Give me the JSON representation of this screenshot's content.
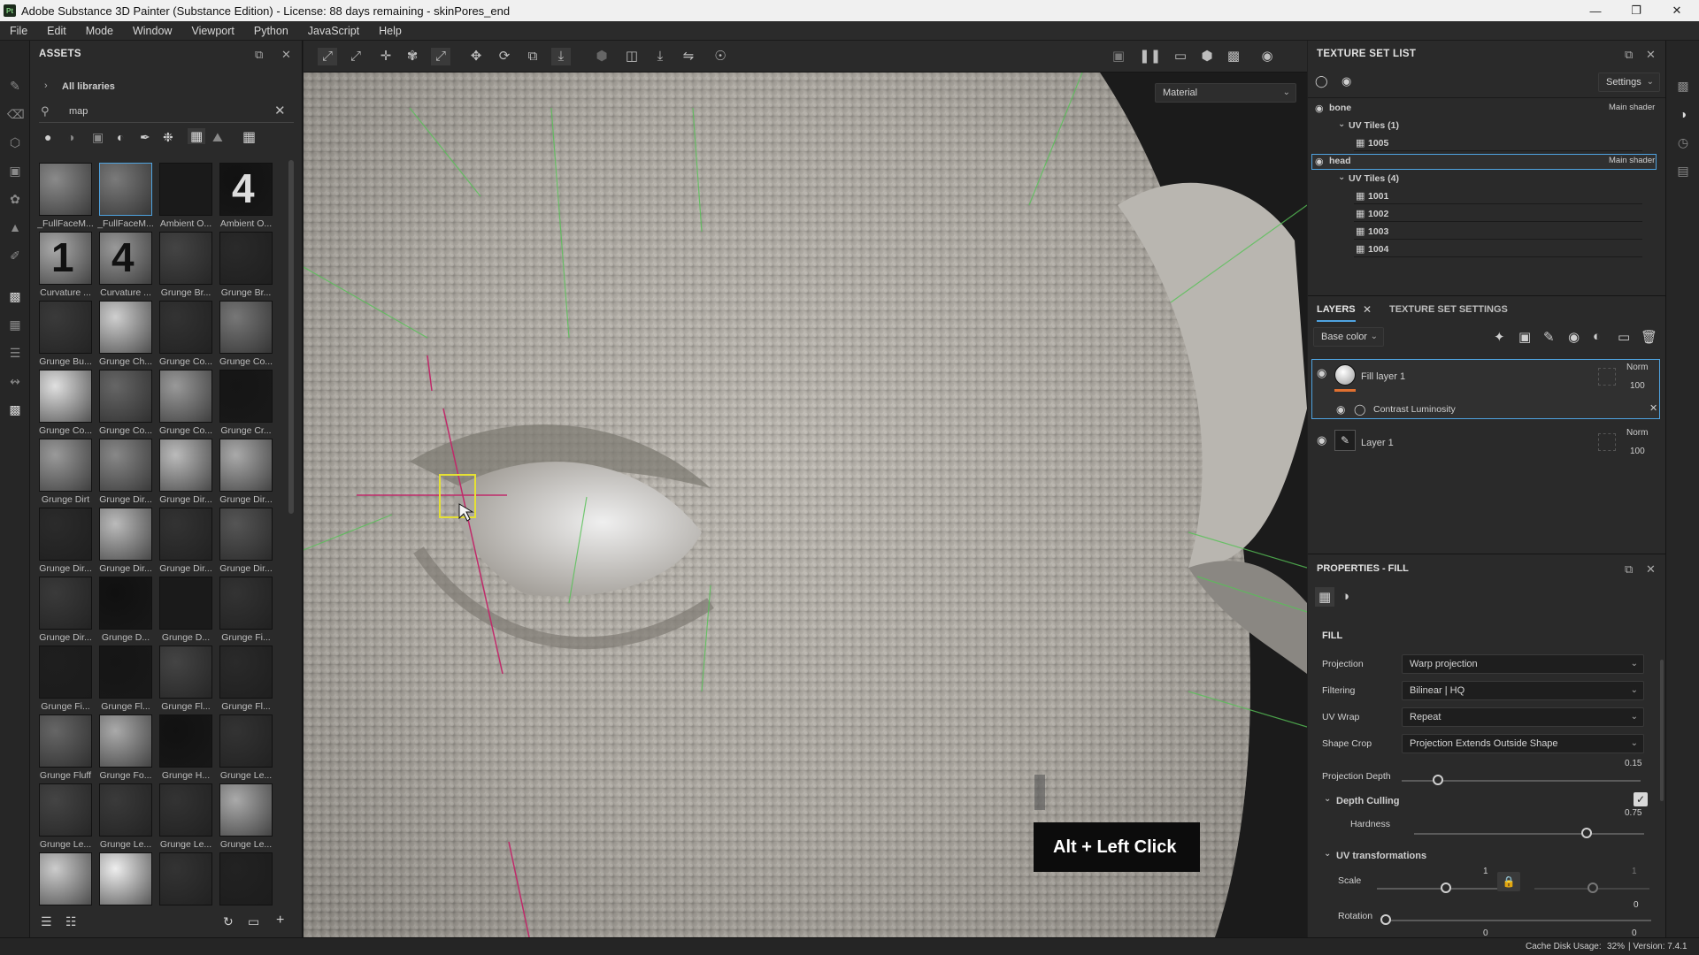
{
  "window": {
    "title": "Adobe Substance 3D Painter (Substance Edition) - License: 88 days remaining - skinPores_end",
    "logo": "Pt"
  },
  "menu": [
    "File",
    "Edit",
    "Mode",
    "Window",
    "Viewport",
    "Python",
    "JavaScript",
    "Help"
  ],
  "assets": {
    "title": "ASSETS",
    "breadcrumb": "All libraries",
    "search_value": "map",
    "items": [
      {
        "label": "_FullFaceM..."
      },
      {
        "label": "_FullFaceM..."
      },
      {
        "label": "Ambient O..."
      },
      {
        "label": "Ambient O..."
      },
      {
        "label": "Curvature ..."
      },
      {
        "label": "Curvature ..."
      },
      {
        "label": "Grunge Br..."
      },
      {
        "label": "Grunge Br..."
      },
      {
        "label": "Grunge Bu..."
      },
      {
        "label": "Grunge Ch..."
      },
      {
        "label": "Grunge Co..."
      },
      {
        "label": "Grunge Co..."
      },
      {
        "label": "Grunge Co..."
      },
      {
        "label": "Grunge Co..."
      },
      {
        "label": "Grunge Co..."
      },
      {
        "label": "Grunge Cr..."
      },
      {
        "label": "Grunge Dirt"
      },
      {
        "label": "Grunge Dir..."
      },
      {
        "label": "Grunge Dir..."
      },
      {
        "label": "Grunge Dir..."
      },
      {
        "label": "Grunge Dir..."
      },
      {
        "label": "Grunge Dir..."
      },
      {
        "label": "Grunge Dir..."
      },
      {
        "label": "Grunge Dir..."
      },
      {
        "label": "Grunge Dir..."
      },
      {
        "label": "Grunge D..."
      },
      {
        "label": "Grunge D..."
      },
      {
        "label": "Grunge Fi..."
      },
      {
        "label": "Grunge Fi..."
      },
      {
        "label": "Grunge Fl..."
      },
      {
        "label": "Grunge Fl..."
      },
      {
        "label": "Grunge Fl..."
      },
      {
        "label": "Grunge Fluff"
      },
      {
        "label": "Grunge Fo..."
      },
      {
        "label": "Grunge H..."
      },
      {
        "label": "Grunge Le..."
      },
      {
        "label": "Grunge Le..."
      },
      {
        "label": "Grunge Le..."
      },
      {
        "label": "Grunge Le..."
      },
      {
        "label": "Grunge Le..."
      },
      {
        "label": ""
      },
      {
        "label": ""
      },
      {
        "label": ""
      },
      {
        "label": ""
      }
    ],
    "thumb_glyphs": {
      "4": "1",
      "5": "4",
      "3": "4"
    }
  },
  "viewport": {
    "material_dropdown": "Material",
    "shortcut_hint": "Alt + Left Click"
  },
  "texture_set_list": {
    "title": "TEXTURE SET LIST",
    "settings": "Settings",
    "sets": [
      {
        "name": "bone",
        "shader": "Main shader",
        "uv_group": "UV Tiles (1)",
        "tiles": [
          "1005"
        ]
      },
      {
        "name": "head",
        "shader": "Main shader",
        "uv_group": "UV Tiles (4)",
        "tiles": [
          "1001",
          "1002",
          "1003",
          "1004"
        ]
      }
    ]
  },
  "layers": {
    "tab_layers": "LAYERS",
    "tab_settings": "TEXTURE SET SETTINGS",
    "channel": "Base color",
    "items": [
      {
        "name": "Fill layer 1",
        "blend": "Norm",
        "opacity": "100"
      },
      {
        "name": "Layer 1",
        "blend": "Norm",
        "opacity": "100"
      }
    ],
    "effect": "Contrast Luminosity"
  },
  "properties": {
    "title": "PROPERTIES - FILL",
    "section": "FILL",
    "fields": [
      {
        "label": "Projection",
        "value": "Warp projection"
      },
      {
        "label": "Filtering",
        "value": "Bilinear | HQ"
      },
      {
        "label": "UV Wrap",
        "value": "Repeat"
      },
      {
        "label": "Shape Crop",
        "value": "Projection Extends Outside Shape"
      }
    ],
    "projection_depth": {
      "label": "Projection Depth",
      "value": "0.15",
      "level": 0.15
    },
    "depth_culling": {
      "label": "Depth Culling",
      "hardness_label": "Hardness",
      "hardness": "0.75",
      "level": 0.75
    },
    "uv_transform": {
      "label": "UV transformations",
      "scale_label": "Scale",
      "scale": "1",
      "scale_right": "1",
      "rotation_label": "Rotation",
      "rotation": "0",
      "rot_left": "0",
      "rot_right": "0"
    }
  },
  "status": {
    "cache": "Cache Disk Usage:",
    "cache_value": "32%",
    "version": "| Version: 7.4.1"
  }
}
